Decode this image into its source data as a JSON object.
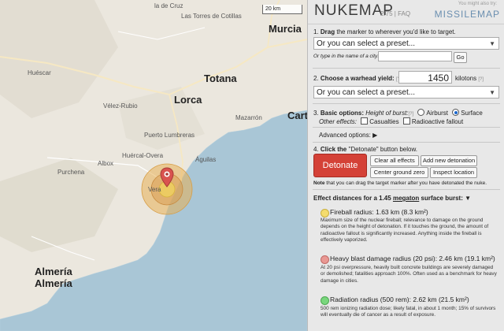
{
  "map": {
    "scale_label": "20 km",
    "places": [
      {
        "id": "la-de-cruz",
        "text": "la de Cruz",
        "cls": "small"
      },
      {
        "id": "las-torres",
        "text": "Las Torres de Cotillas",
        "cls": "small"
      },
      {
        "id": "murcia",
        "text": "Murcia",
        "cls": "big"
      },
      {
        "id": "huescar",
        "text": "Huéscar",
        "cls": "small"
      },
      {
        "id": "totana",
        "text": "Totana",
        "cls": "big"
      },
      {
        "id": "lorca",
        "text": "Lorca",
        "cls": "big"
      },
      {
        "id": "velez-rubio",
        "text": "Vélez-Rubio",
        "cls": "small"
      },
      {
        "id": "mazarron",
        "text": "Mazarrón",
        "cls": "small"
      },
      {
        "id": "cart",
        "text": "Cart",
        "cls": "big"
      },
      {
        "id": "albox",
        "text": "Albox",
        "cls": "small"
      },
      {
        "id": "huercal-overa",
        "text": "Huércal-Overa",
        "cls": "small"
      },
      {
        "id": "puerto-lumbreras",
        "text": "Puerto Lumbreras",
        "cls": "small"
      },
      {
        "id": "aguilas",
        "text": "Águilas",
        "cls": "small"
      },
      {
        "id": "purchena",
        "text": "Purchena",
        "cls": "small"
      },
      {
        "id": "vera",
        "text": "Vera",
        "cls": "small"
      },
      {
        "id": "almeria",
        "text": "Almería",
        "cls": "big"
      },
      {
        "id": "almeria2",
        "text": "Almería",
        "cls": "big"
      }
    ],
    "effect_colors": {
      "fireball": "#f4dc6e",
      "blast": "#e99893",
      "radiation": "#79d67d"
    }
  },
  "panel": {
    "logo": "NUKEMAP",
    "version": "2.75",
    "faq": "FAQ",
    "also_try": "You might also try:",
    "missilemap": "MISSILEMAP",
    "step1_num": "1.",
    "step1_bold": "Drag",
    "step1_rest": "the marker to wherever you'd like to target.",
    "preset_target": "Or you can select a preset...",
    "city_label": "Or type in the name of a city:",
    "city_value": "",
    "go": "Go",
    "step2_num": "2.",
    "step2_bold": "Choose a warhead yield:",
    "help": "[?]",
    "yield_value": "1450",
    "yield_unit": "kilotons",
    "preset_yield": "Or you can select a preset...",
    "step3_num": "3.",
    "step3_bold": "Basic options:",
    "height_label": "Height of burst:",
    "airburst": "Airburst",
    "surface": "Surface",
    "other_effects": "Other effects:",
    "casualties": "Casualties",
    "fallout": "Radioactive fallout",
    "advanced": "Advanced options:",
    "adv_arrow": "▶",
    "step4_num": "4.",
    "step4_pre": "Click the",
    "step4_quote": "\"Detonate\"",
    "step4_post": "button below.",
    "detonate": "Detonate",
    "clear_all": "Clear all effects",
    "add_new": "Add new detonation",
    "center_zero": "Center ground zero",
    "inspect": "Inspect location",
    "note_bold": "Note",
    "note_rest": "that you can drag the target marker after you have detonated the nuke.",
    "effects_title_pre": "Effect distances for a 1.45",
    "effects_title_mid": "megaton",
    "effects_title_post": "surface burst:",
    "effects_arrow": "▼",
    "effects": [
      {
        "title": "Fireball radius: 1.63 km (8.3 km²)",
        "desc": "Maximum size of the nuclear fireball; relevance to damage on the ground depends on the height of detonation. If it touches the ground, the amount of radioactive fallout is significantly increased. Anything inside the fireball is effectively vaporized."
      },
      {
        "title": "Heavy blast damage radius (20 psi): 2.46 km (19.1 km²)",
        "desc": "At 20 psi overpressure, heavily built concrete buildings are severely damaged or demolished; fatalities approach 100%. Often used as a benchmark for heavy damage in cities."
      },
      {
        "title": "Radiation radius (500 rem): 2.62 km (21.5 km²)",
        "desc": "500 rem ionizing radiation dose; likely fatal, in about 1 month; 15% of survivors will eventually die of cancer as a result of exposure."
      }
    ]
  }
}
